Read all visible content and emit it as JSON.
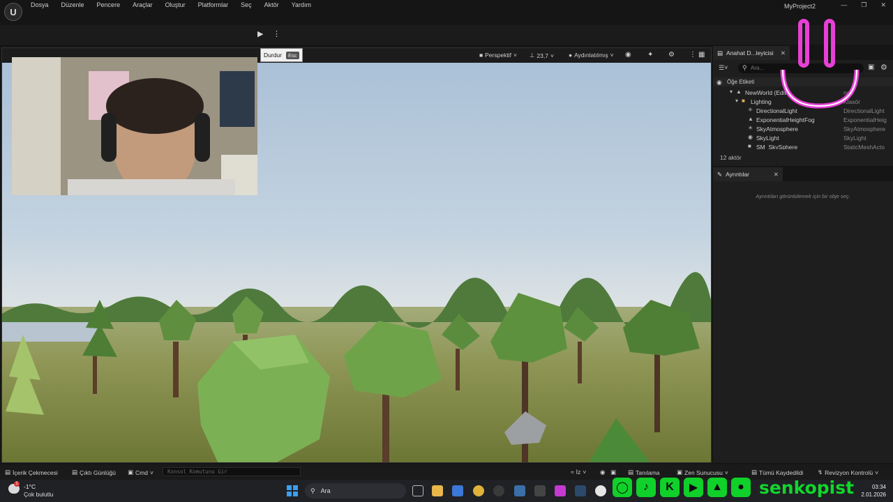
{
  "menubar": {
    "items": [
      "Dosya",
      "Düzenle",
      "Pencere",
      "Araçlar",
      "Oluştur",
      "Platformlar",
      "Seç",
      "Aktör",
      "Yardım"
    ],
    "project_name": "MyProject2"
  },
  "toolbar": {
    "tooltip_label": "Durdur",
    "tooltip_key": "Esc"
  },
  "viewport": {
    "perspective": "Perspektif",
    "fov": "23,7",
    "lighting": "Aydınlatılmış"
  },
  "outliner": {
    "tab_title": "Anahat D...leyicisi",
    "search_placeholder": "Ara...",
    "column_label": "Öğe Etiketi",
    "rows": [
      {
        "name": "NewWorld (Edito",
        "type": "nya"
      },
      {
        "name": "Lighting",
        "type": "Klasör"
      },
      {
        "name": "DirectionalLight",
        "type": "DirectionalLight"
      },
      {
        "name": "ExponentialHeightFog",
        "type": "ExponentialHeig"
      },
      {
        "name": "SkyAtmosphere",
        "type": "SkyAtmosphere"
      },
      {
        "name": "SkyLight",
        "type": "SkyLight"
      },
      {
        "name": "SM_SkySphere",
        "type": "StaticMeshActo"
      }
    ],
    "actor_count": "12 aktör"
  },
  "details": {
    "tab_title": "Ayrıntılar",
    "empty_message": "Ayrıntıları görüntülemek için bir obje seç."
  },
  "statusbar": {
    "content_drawer": "İçerik Çekmecesi",
    "output_log": "Çıktı Günlüğü",
    "cmd": "Cmd",
    "console_placeholder": "Konsol Komutunu Gir",
    "trace": "İz",
    "diagnostics": "Tanılama",
    "zen": "Zen Sunucusu",
    "saved": "Tümü Kaydedildi",
    "revision": "Revizyon Kontrolü"
  },
  "taskbar": {
    "weather_badge": "1",
    "temperature": "-1°C",
    "condition": "Çok bulutlu",
    "search_label": "Ara",
    "time": "03:34",
    "date": "2.01.2026"
  },
  "overlay": {
    "brand": "senkopist"
  },
  "colors": {
    "accent_green": "#12d62b",
    "smiley_pink": "#e83fd6",
    "panel_bg": "#1e1e1e"
  }
}
